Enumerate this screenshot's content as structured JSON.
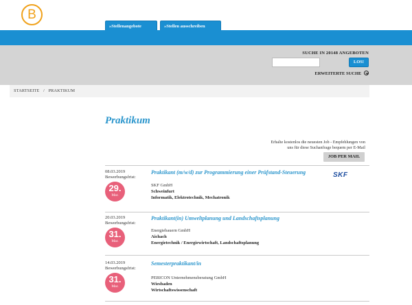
{
  "header": {
    "logo_letter": "B",
    "tabs": [
      "»Stellenangebote",
      "»Stellen ausschreiben"
    ]
  },
  "search": {
    "label": "SUCHE IN 20148 ANGEBOTEN",
    "input_value": "",
    "button_label": "LOS!",
    "advanced_label": "ERWEITERTE SUCHE"
  },
  "breadcrumb": {
    "home": "STARTSEITE",
    "separator": "/",
    "current": "PRAKTIKUM"
  },
  "main": {
    "title": "Praktikum",
    "mail_text_line1": "Erhalte kostenlos die neuesten Job - Empfehlungen von",
    "mail_text_line2": "uns für diese Suchanfrage bequem per E-Mail",
    "mail_button": "JOB PER MAIL"
  },
  "jobs": [
    {
      "date": "08.03.2019",
      "deadline_label": "Bewerbungsfrist:",
      "deadline_day": "29.",
      "deadline_month": "Mar.",
      "title": "Praktikant (m/w/d) zur Programmierung einer Prüfstand-Steuerung",
      "company": "SKF GmbH",
      "city": "Schweinfurt",
      "field": "Informatik, Elektrotechnik, Mechatronik",
      "logo_text": "SKF"
    },
    {
      "date": "20.03.2019",
      "deadline_label": "Bewerbungsfrist:",
      "deadline_day": "31.",
      "deadline_month": "Mar.",
      "title": "Praktikant(in) Umweltplanung und Landschaftsplanung",
      "company": "Energiebauern GmbH",
      "city": "Aichach",
      "field": "Energietechnik / Energiewirtschaft, Landschaftsplanung"
    },
    {
      "date": "14.03.2019",
      "deadline_label": "Bewerbungsfrist:",
      "deadline_day": "31.",
      "deadline_month": "Mar.",
      "title": "Semesterpraktikant/in",
      "company": "PERICON Unternehmensberatung GmbH",
      "city": "Wiesbaden",
      "field": "Wirtschaftswissenschaft"
    }
  ],
  "colors": {
    "accent_blue": "#1a8fd2",
    "title_blue": "#2a95cc",
    "badge_pink": "#e8607a",
    "logo_orange": "#f0a11a"
  }
}
